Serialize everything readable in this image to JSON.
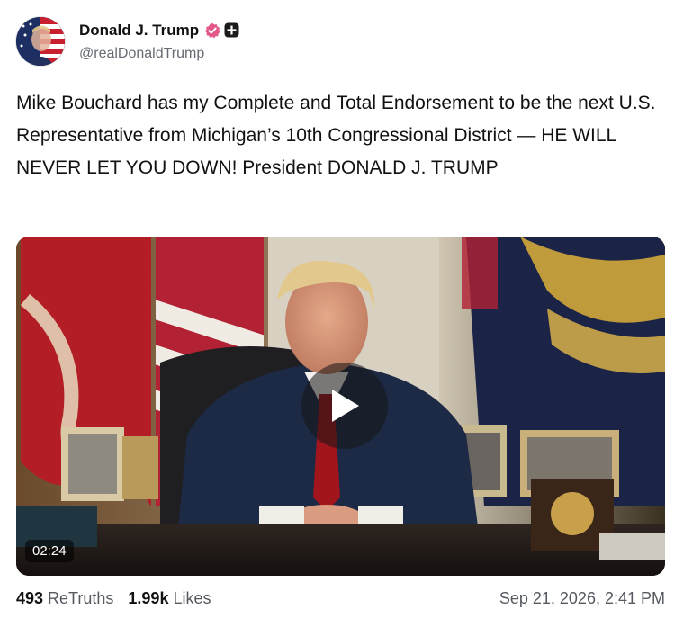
{
  "author": {
    "display_name": "Donald J. Trump",
    "handle": "@realDonaldTrump",
    "avatar_icon": "flag-portrait-avatar",
    "verified_icon": "verified-badge-icon",
    "verified_color": "#e4578a",
    "plus_icon": "plus-badge-icon"
  },
  "post": {
    "text": "Mike Bouchard has my Complete and Total Endorsement to be the next U.S. Representative from Michigan’s 10th Congressional District — HE WILL NEVER LET YOU DOWN! President DONALD J. TRUMP"
  },
  "media": {
    "type": "video",
    "duration": "02:24",
    "play_icon": "play-icon"
  },
  "stats": {
    "retruths_count": "493",
    "retruths_label": "ReTruths",
    "likes_count": "1.99k",
    "likes_label": "Likes",
    "timestamp": "Sep 21, 2026, 2:41 PM"
  }
}
